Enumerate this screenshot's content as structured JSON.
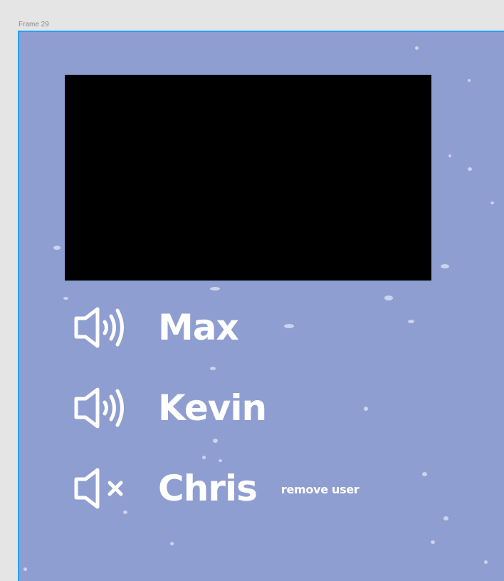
{
  "frame": {
    "label": "Frame 29"
  },
  "users": [
    {
      "name": "Max",
      "audio": "speaker-on-icon"
    },
    {
      "name": "Kevin",
      "audio": "speaker-on-icon"
    },
    {
      "name": "Chris",
      "audio": "speaker-muted-icon"
    }
  ],
  "actions": {
    "remove_user_label": "remove user"
  },
  "colors": {
    "frame_background": "#8f9ed1",
    "frame_border": "#2ba0ee",
    "video_background": "#000000",
    "text": "#ffffff"
  }
}
